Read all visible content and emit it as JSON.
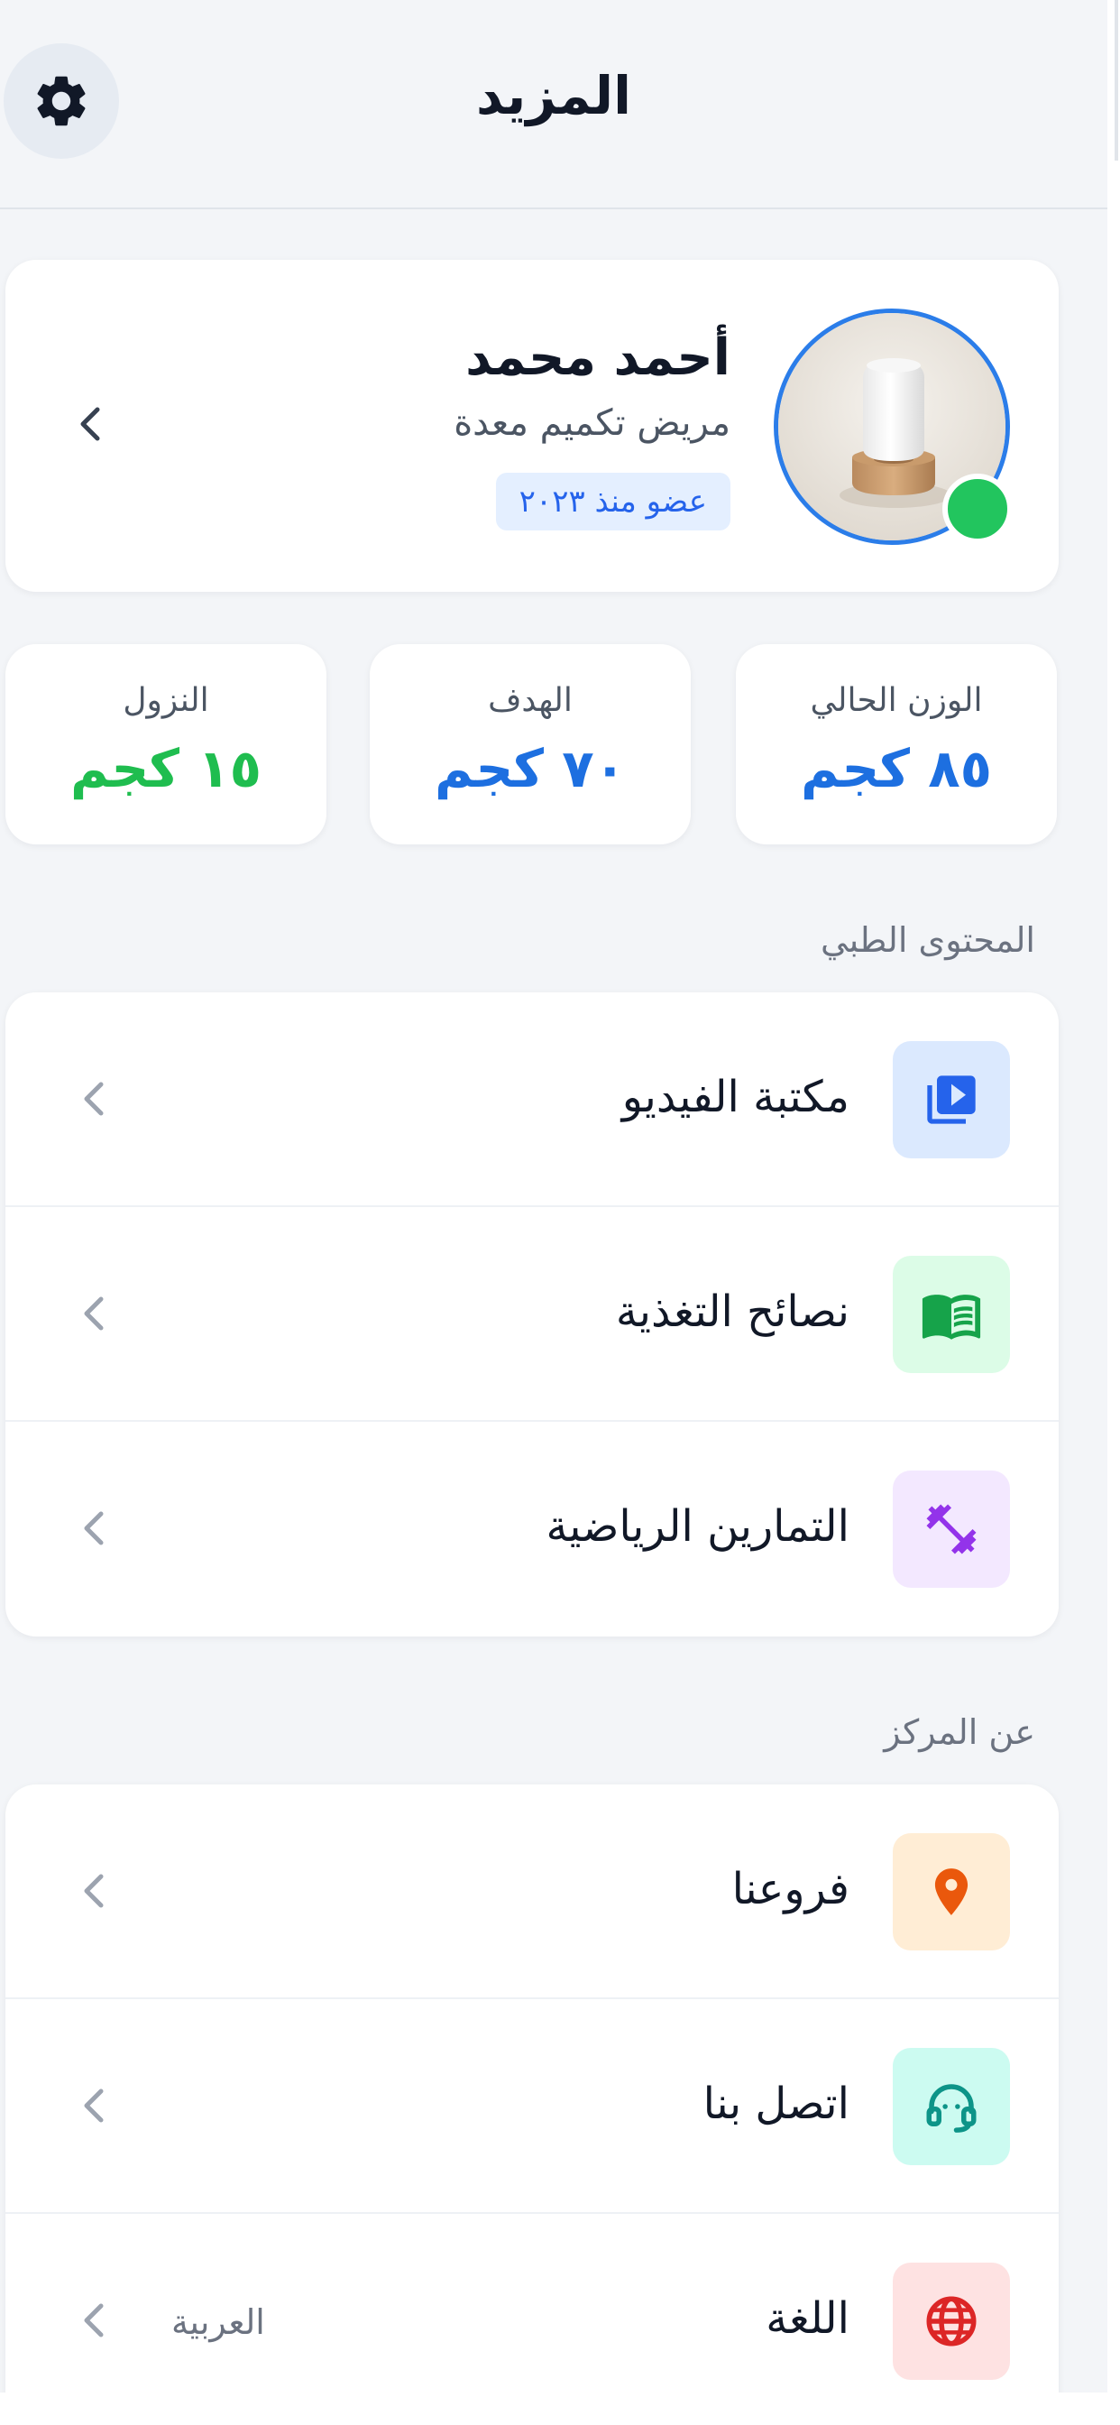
{
  "header": {
    "title": "المزيد",
    "settings_icon": "gear-icon"
  },
  "profile": {
    "name": "أحمد محمد",
    "subtitle": "مريض تكميم معدة",
    "member_since": "عضو منذ ٢٠٢٣",
    "online": true,
    "avatar_icon": "avatar-image",
    "chevron_icon": "chevron-left-icon"
  },
  "stats": [
    {
      "label": "الوزن الحالي",
      "value": "٨٥ كجم",
      "color": "#1d6fe0"
    },
    {
      "label": "الهدف",
      "value": "٧٠ كجم",
      "color": "#1d6fe0"
    },
    {
      "label": "النزول",
      "value": "١٥ كجم",
      "color": "#1fbd4f"
    }
  ],
  "sections": [
    {
      "title": "المحتوى الطبي",
      "items": [
        {
          "label": "مكتبة الفيديو",
          "icon": "video-library-icon",
          "bg": "#dbe9fe",
          "fg": "#2563eb"
        },
        {
          "label": "نصائح التغذية",
          "icon": "book-icon",
          "bg": "#dcfce7",
          "fg": "#16a34a"
        },
        {
          "label": "التمارين الرياضية",
          "icon": "dumbbell-icon",
          "bg": "#f3e8ff",
          "fg": "#9333ea"
        }
      ]
    },
    {
      "title": "عن المركز",
      "items": [
        {
          "label": "فروعنا",
          "icon": "location-pin-icon",
          "bg": "#ffedd5",
          "fg": "#ea580c"
        },
        {
          "label": "اتصل بنا",
          "icon": "headset-icon",
          "bg": "#ccfbf1",
          "fg": "#0d9488"
        },
        {
          "label": "اللغة",
          "value": "العربية",
          "icon": "globe-icon",
          "bg": "#fee2e2",
          "fg": "#dc2626"
        }
      ]
    }
  ]
}
